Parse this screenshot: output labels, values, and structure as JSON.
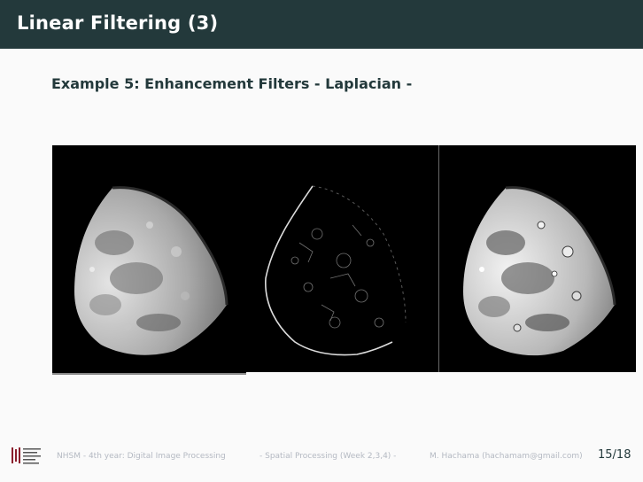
{
  "slide": {
    "title": "Linear Filtering (3)",
    "heading": "Example 5: Enhancement Filters - Laplacian -",
    "colors": {
      "title_bar": "#23393b",
      "heading_text": "#23393b",
      "footer_text": "#b4b9c2"
    }
  },
  "figure": {
    "panels": [
      {
        "name": "original-moon",
        "content": "grayscale moon image"
      },
      {
        "name": "laplacian-moon",
        "content": "Laplacian-filtered edge image"
      },
      {
        "name": "enhanced-moon",
        "content": "sharpened moon image"
      }
    ]
  },
  "footer": {
    "course": "NHSM - 4th year: Digital Image Processing",
    "section": "- Spatial Processing (Week 2,3,4) -",
    "author": "M. Hachama (hachamam@gmail.com)",
    "page": "15/18",
    "logo_icon": "nhsm-logo-icon"
  }
}
